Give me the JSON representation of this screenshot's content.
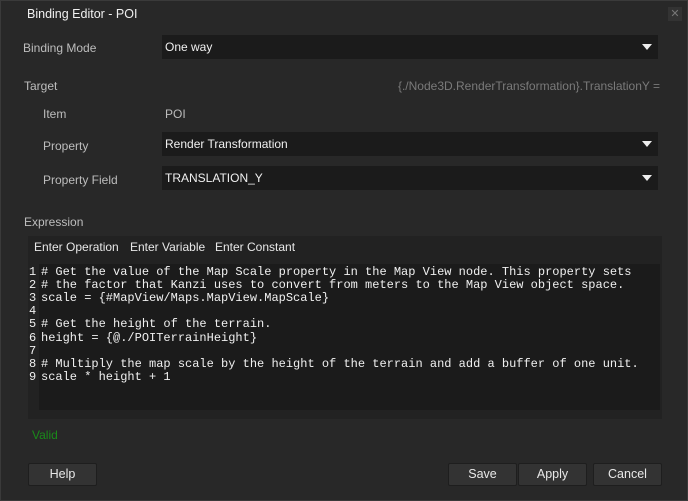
{
  "window": {
    "title": "Binding Editor - POI",
    "close_icon": "close-icon"
  },
  "binding_mode": {
    "label": "Binding Mode",
    "value": "One way"
  },
  "target": {
    "label": "Target",
    "hint": "{./Node3D.RenderTransformation}.TranslationY =",
    "item_label": "Item",
    "item_value": "POI",
    "property_label": "Property",
    "property_value": "Render Transformation",
    "field_label": "Property Field",
    "field_value": "TRANSLATION_Y"
  },
  "expression": {
    "label": "Expression",
    "toolbar": [
      "Enter Operation",
      "Enter Variable",
      "Enter Constant"
    ],
    "lines": [
      {
        "n": "1",
        "text": "# Get the value of the Map Scale property in the Map View node. This property sets"
      },
      {
        "n": "2",
        "text": "# the factor that Kanzi uses to convert from meters to the Map View object space."
      },
      {
        "n": "3",
        "text": "scale = {#MapView/Maps.MapView.MapScale}"
      },
      {
        "n": "4",
        "text": ""
      },
      {
        "n": "5",
        "text": "# Get the height of the terrain."
      },
      {
        "n": "6",
        "text": "height = {@./POITerrainHeight}"
      },
      {
        "n": "7",
        "text": ""
      },
      {
        "n": "8",
        "text": "# Multiply the map scale by the height of the terrain and add a buffer of one unit."
      },
      {
        "n": "9",
        "text": "scale * height + 1"
      }
    ]
  },
  "status": {
    "text": "Valid",
    "color": "#1a8a1a"
  },
  "buttons": {
    "help": "Help",
    "save": "Save",
    "apply": "Apply",
    "cancel": "Cancel"
  }
}
